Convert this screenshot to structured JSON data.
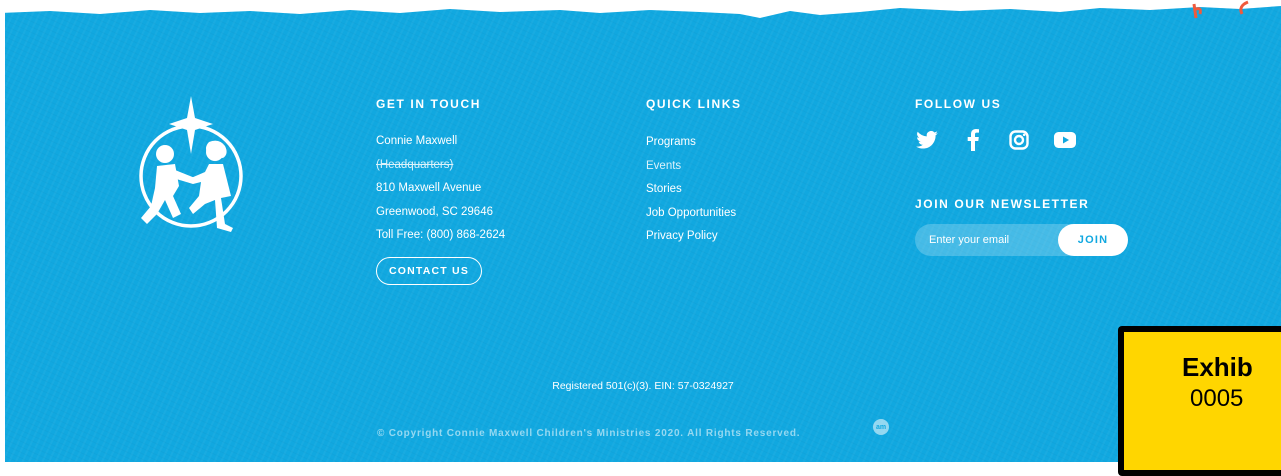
{
  "logo": {
    "icon": "children-star-logo-icon"
  },
  "get_in_touch": {
    "heading": "GET IN TOUCH",
    "lines": [
      "Connie Maxwell",
      "(Headquarters)",
      "810 Maxwell Avenue",
      "Greenwood, SC 29646",
      "Toll Free: (800) 868-2624"
    ],
    "contact_button": "CONTACT US"
  },
  "quick_links": {
    "heading": "QUICK LINKS",
    "items": [
      "Programs",
      "Events",
      "Stories",
      "Job Opportunities",
      "Privacy Policy"
    ]
  },
  "follow_us": {
    "heading": "FOLLOW US",
    "icons": [
      "twitter-icon",
      "facebook-icon",
      "instagram-icon",
      "youtube-icon"
    ]
  },
  "newsletter": {
    "heading": "JOIN OUR NEWSLETTER",
    "placeholder": "Enter your email",
    "join_label": "JOIN"
  },
  "registered": "Registered 501(c)(3). EIN: 57-0324927",
  "copyright": "© Copyright Connie Maxwell Children's Ministries 2020. All Rights Reserved.",
  "badge": "am",
  "exhibit": {
    "title": "Exhib",
    "number": "0005"
  },
  "colors": {
    "footer_bg": "#11a8e0",
    "text": "#ffffff",
    "exhibit_bg": "#ffd600",
    "accent_red": "#f05a3c"
  }
}
